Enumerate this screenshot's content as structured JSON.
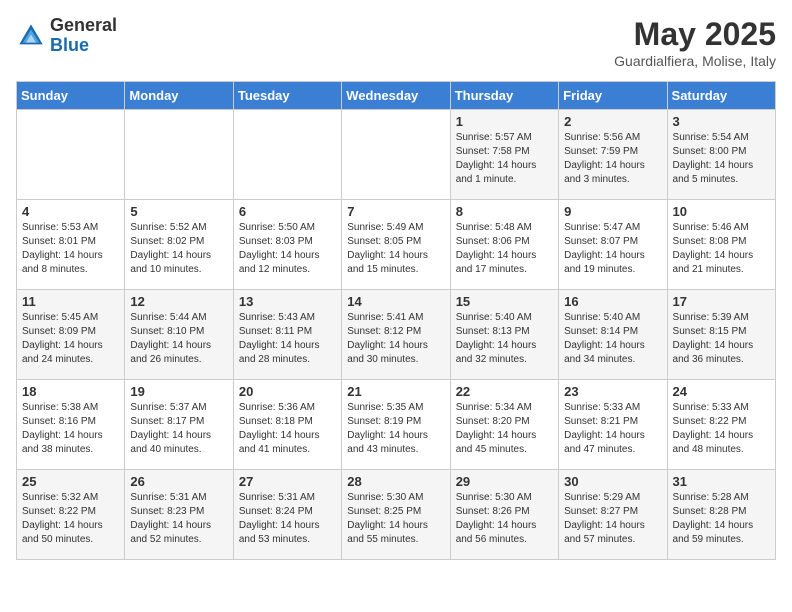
{
  "header": {
    "logo": {
      "general": "General",
      "blue": "Blue"
    },
    "title": "May 2025",
    "subtitle": "Guardialfiera, Molise, Italy"
  },
  "days_header": [
    "Sunday",
    "Monday",
    "Tuesday",
    "Wednesday",
    "Thursday",
    "Friday",
    "Saturday"
  ],
  "weeks": [
    [
      {
        "day": "",
        "info": ""
      },
      {
        "day": "",
        "info": ""
      },
      {
        "day": "",
        "info": ""
      },
      {
        "day": "",
        "info": ""
      },
      {
        "day": "1",
        "info": "Sunrise: 5:57 AM\nSunset: 7:58 PM\nDaylight: 14 hours and 1 minute."
      },
      {
        "day": "2",
        "info": "Sunrise: 5:56 AM\nSunset: 7:59 PM\nDaylight: 14 hours and 3 minutes."
      },
      {
        "day": "3",
        "info": "Sunrise: 5:54 AM\nSunset: 8:00 PM\nDaylight: 14 hours and 5 minutes."
      }
    ],
    [
      {
        "day": "4",
        "info": "Sunrise: 5:53 AM\nSunset: 8:01 PM\nDaylight: 14 hours and 8 minutes."
      },
      {
        "day": "5",
        "info": "Sunrise: 5:52 AM\nSunset: 8:02 PM\nDaylight: 14 hours and 10 minutes."
      },
      {
        "day": "6",
        "info": "Sunrise: 5:50 AM\nSunset: 8:03 PM\nDaylight: 14 hours and 12 minutes."
      },
      {
        "day": "7",
        "info": "Sunrise: 5:49 AM\nSunset: 8:05 PM\nDaylight: 14 hours and 15 minutes."
      },
      {
        "day": "8",
        "info": "Sunrise: 5:48 AM\nSunset: 8:06 PM\nDaylight: 14 hours and 17 minutes."
      },
      {
        "day": "9",
        "info": "Sunrise: 5:47 AM\nSunset: 8:07 PM\nDaylight: 14 hours and 19 minutes."
      },
      {
        "day": "10",
        "info": "Sunrise: 5:46 AM\nSunset: 8:08 PM\nDaylight: 14 hours and 21 minutes."
      }
    ],
    [
      {
        "day": "11",
        "info": "Sunrise: 5:45 AM\nSunset: 8:09 PM\nDaylight: 14 hours and 24 minutes."
      },
      {
        "day": "12",
        "info": "Sunrise: 5:44 AM\nSunset: 8:10 PM\nDaylight: 14 hours and 26 minutes."
      },
      {
        "day": "13",
        "info": "Sunrise: 5:43 AM\nSunset: 8:11 PM\nDaylight: 14 hours and 28 minutes."
      },
      {
        "day": "14",
        "info": "Sunrise: 5:41 AM\nSunset: 8:12 PM\nDaylight: 14 hours and 30 minutes."
      },
      {
        "day": "15",
        "info": "Sunrise: 5:40 AM\nSunset: 8:13 PM\nDaylight: 14 hours and 32 minutes."
      },
      {
        "day": "16",
        "info": "Sunrise: 5:40 AM\nSunset: 8:14 PM\nDaylight: 14 hours and 34 minutes."
      },
      {
        "day": "17",
        "info": "Sunrise: 5:39 AM\nSunset: 8:15 PM\nDaylight: 14 hours and 36 minutes."
      }
    ],
    [
      {
        "day": "18",
        "info": "Sunrise: 5:38 AM\nSunset: 8:16 PM\nDaylight: 14 hours and 38 minutes."
      },
      {
        "day": "19",
        "info": "Sunrise: 5:37 AM\nSunset: 8:17 PM\nDaylight: 14 hours and 40 minutes."
      },
      {
        "day": "20",
        "info": "Sunrise: 5:36 AM\nSunset: 8:18 PM\nDaylight: 14 hours and 41 minutes."
      },
      {
        "day": "21",
        "info": "Sunrise: 5:35 AM\nSunset: 8:19 PM\nDaylight: 14 hours and 43 minutes."
      },
      {
        "day": "22",
        "info": "Sunrise: 5:34 AM\nSunset: 8:20 PM\nDaylight: 14 hours and 45 minutes."
      },
      {
        "day": "23",
        "info": "Sunrise: 5:33 AM\nSunset: 8:21 PM\nDaylight: 14 hours and 47 minutes."
      },
      {
        "day": "24",
        "info": "Sunrise: 5:33 AM\nSunset: 8:22 PM\nDaylight: 14 hours and 48 minutes."
      }
    ],
    [
      {
        "day": "25",
        "info": "Sunrise: 5:32 AM\nSunset: 8:22 PM\nDaylight: 14 hours and 50 minutes."
      },
      {
        "day": "26",
        "info": "Sunrise: 5:31 AM\nSunset: 8:23 PM\nDaylight: 14 hours and 52 minutes."
      },
      {
        "day": "27",
        "info": "Sunrise: 5:31 AM\nSunset: 8:24 PM\nDaylight: 14 hours and 53 minutes."
      },
      {
        "day": "28",
        "info": "Sunrise: 5:30 AM\nSunset: 8:25 PM\nDaylight: 14 hours and 55 minutes."
      },
      {
        "day": "29",
        "info": "Sunrise: 5:30 AM\nSunset: 8:26 PM\nDaylight: 14 hours and 56 minutes."
      },
      {
        "day": "30",
        "info": "Sunrise: 5:29 AM\nSunset: 8:27 PM\nDaylight: 14 hours and 57 minutes."
      },
      {
        "day": "31",
        "info": "Sunrise: 5:28 AM\nSunset: 8:28 PM\nDaylight: 14 hours and 59 minutes."
      }
    ]
  ]
}
